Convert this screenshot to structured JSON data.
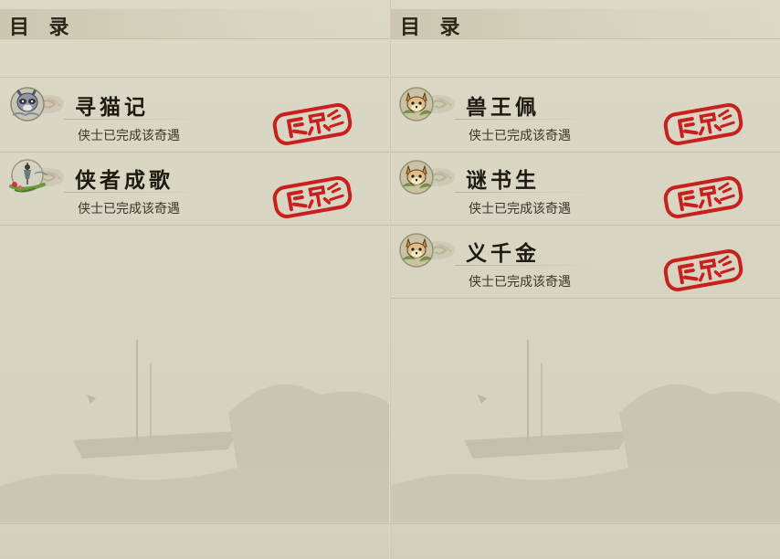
{
  "left_panel": {
    "title": "目 录",
    "entries": [
      {
        "name": "寻猫记",
        "description": "侠士已完成该奇遇",
        "icon": "raccoon-icon",
        "stamp_icon": "completed-stamp-icon"
      },
      {
        "name": "侠者成歌",
        "description": "侠士已完成该奇遇",
        "icon": "swordsman-boat-icon",
        "stamp_icon": "completed-stamp-icon"
      }
    ]
  },
  "right_panel": {
    "title": "目 录",
    "entries": [
      {
        "name": "兽王佩",
        "description": "侠士已完成该奇遇",
        "icon": "fox-icon",
        "stamp_icon": "completed-stamp-icon"
      },
      {
        "name": "谜书生",
        "description": "侠士已完成该奇遇",
        "icon": "fox-icon",
        "stamp_icon": "completed-stamp-icon"
      },
      {
        "name": "义千金",
        "description": "侠士已完成该奇遇",
        "icon": "fox-icon",
        "stamp_icon": "completed-stamp-icon"
      }
    ]
  },
  "colors": {
    "stamp_red": "#c8201c",
    "paper": "#dcd8c7",
    "text_dark": "#1e1a12"
  }
}
